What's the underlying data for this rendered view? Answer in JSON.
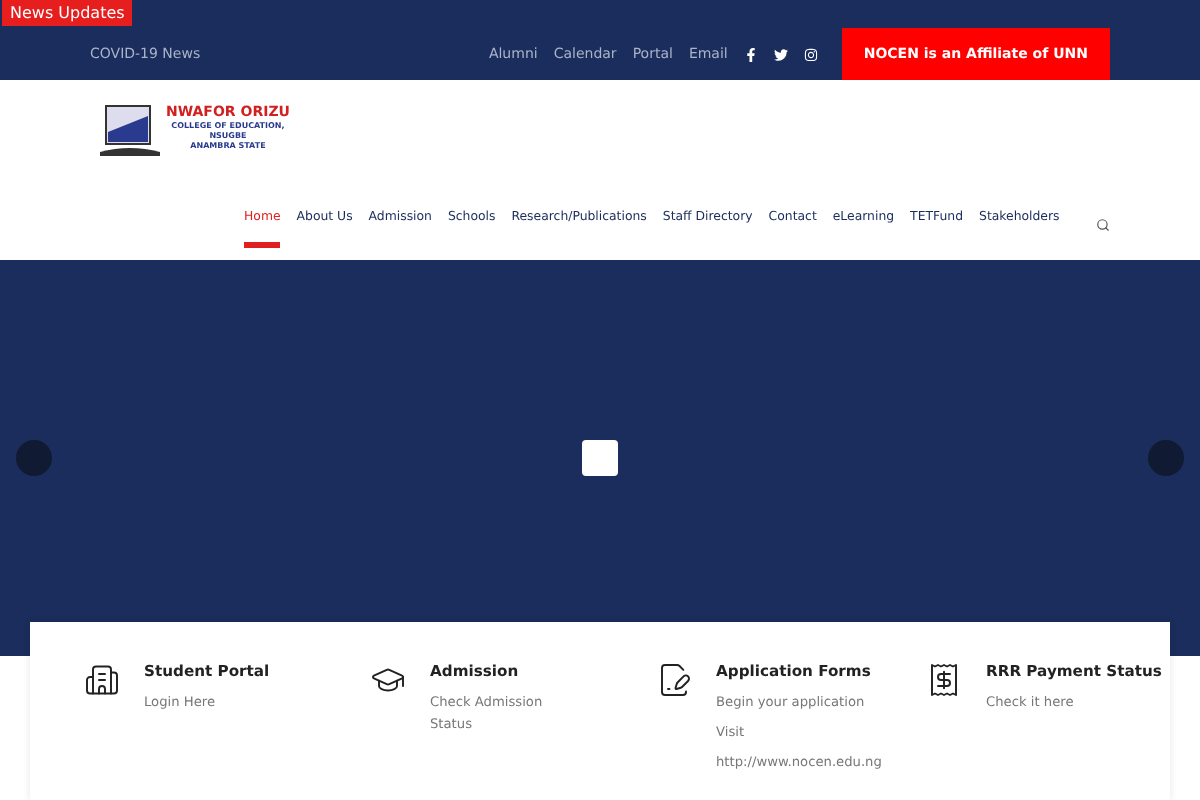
{
  "news_badge": "News Updates",
  "top_bar": {
    "left_link": "COVID-19 News",
    "links": [
      "Alumni",
      "Calendar",
      "Portal",
      "Email"
    ],
    "cta": "NOCEN is an Affiliate of UNN"
  },
  "logo": {
    "name": "NWAFOR ORIZU",
    "lines": [
      "COLLEGE OF EDUCATION,",
      "NSUGBE",
      "ANAMBRA STATE"
    ]
  },
  "nav": [
    {
      "label": "Home",
      "selected": true
    },
    {
      "label": "About Us",
      "selected": false
    },
    {
      "label": "Admission",
      "selected": false
    },
    {
      "label": "Schools",
      "selected": false
    },
    {
      "label": "Research/Publications",
      "selected": false
    },
    {
      "label": "Staff Directory",
      "selected": false
    },
    {
      "label": "Contact",
      "selected": false
    },
    {
      "label": "eLearning",
      "selected": false
    },
    {
      "label": "TETFund",
      "selected": false
    },
    {
      "label": "Stakeholders",
      "selected": false
    }
  ],
  "cards": [
    {
      "kind": "building",
      "title": "Student Portal",
      "lines": [
        "Login Here"
      ]
    },
    {
      "kind": "cap",
      "title": "Admission",
      "lines": [
        "Check Admission Status"
      ]
    },
    {
      "kind": "form",
      "title": "Application Forms",
      "lines": [
        "Begin your application",
        "Visit",
        "http://www.nocen.edu.ng"
      ]
    },
    {
      "kind": "payment",
      "title": "RRR Payment Status",
      "lines": [
        "Check it here"
      ]
    }
  ]
}
